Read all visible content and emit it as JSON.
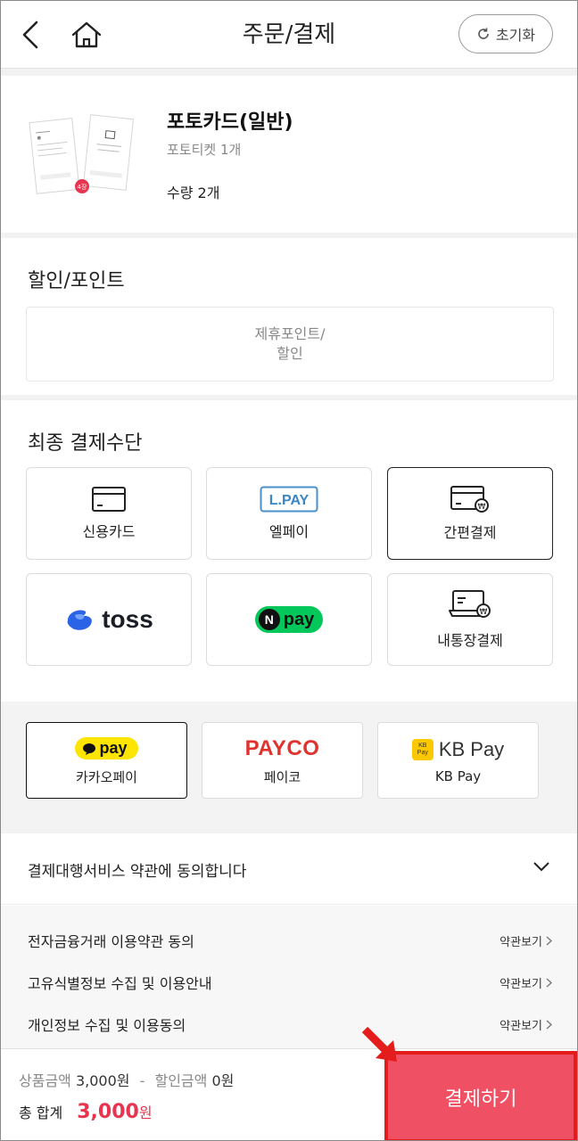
{
  "header": {
    "title": "주문/결제",
    "reset_label": "초기화"
  },
  "product": {
    "name": "포토카드(일반)",
    "subtitle": "포토티켓 1개",
    "quantity": "수량 2개",
    "badge": "4장"
  },
  "discount": {
    "title": "할인/포인트",
    "box_line1": "제휴포인트/",
    "box_line2": "할인"
  },
  "payment": {
    "title": "최종 결제수단",
    "methods": [
      {
        "label": "신용카드",
        "icon": "credit-card-icon",
        "selected": false
      },
      {
        "label": "엘페이",
        "icon": "lpay-logo",
        "logo_text": "L.PAY",
        "selected": false
      },
      {
        "label": "간편결제",
        "icon": "easy-pay-card-icon",
        "selected": true
      },
      {
        "label": "",
        "icon": "toss-logo",
        "logo_text": "toss",
        "selected": false
      },
      {
        "label": "",
        "icon": "npay-logo",
        "logo_text": "pay",
        "selected": false
      },
      {
        "label": "내통장결제",
        "icon": "bank-account-icon",
        "selected": false
      }
    ],
    "easy": [
      {
        "label": "카카오페이",
        "logo_text": "pay",
        "selected": true
      },
      {
        "label": "페이코",
        "logo_text": "PAYCO",
        "selected": false
      },
      {
        "label": "KB Pay",
        "logo_text": "KB Pay",
        "selected": false
      }
    ]
  },
  "agreement": {
    "header": "결제대행서비스 약관에 동의합니다",
    "view_label": "약관보기",
    "items": [
      "전자금융거래 이용약관 동의",
      "고유식별정보 수집 및 이용안내",
      "개인정보 수집 및 이용동의"
    ]
  },
  "footer": {
    "product_amount_label": "상품금액",
    "product_amount": "3,000원",
    "separator": "-",
    "discount_label": "할인금액",
    "discount_amount": "0원",
    "total_label": "총 합계",
    "total_amount": "3,000",
    "total_unit": "원",
    "checkout_label": "결제하기"
  },
  "colors": {
    "accent": "#e8344e",
    "checkout_bg": "#f05063",
    "highlight_border": "#e51c1c"
  }
}
